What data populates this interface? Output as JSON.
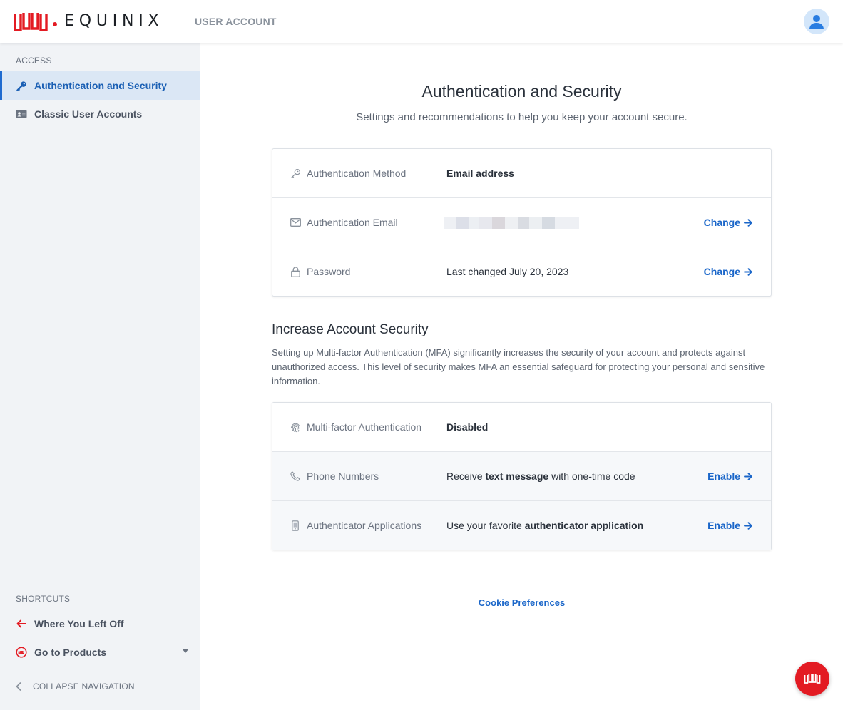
{
  "header": {
    "brand": "EQUINIX",
    "section": "USER ACCOUNT",
    "brand_color": "#e31b23"
  },
  "sidebar": {
    "access_heading": "ACCESS",
    "items": [
      {
        "label": "Authentication and Security",
        "icon": "key-icon",
        "active": true
      },
      {
        "label": "Classic User Accounts",
        "icon": "id-card-icon",
        "active": false
      }
    ],
    "shortcuts_heading": "SHORTCUTS",
    "shortcuts": [
      {
        "label": "Where You Left Off",
        "icon": "arrow-left-icon"
      },
      {
        "label": "Go to Products",
        "icon": "products-icon"
      }
    ],
    "collapse_label": "COLLAPSE NAVIGATION"
  },
  "main": {
    "title": "Authentication and Security",
    "subtitle": "Settings and recommendations to help you keep your account secure.",
    "auth_card": {
      "rows": [
        {
          "label": "Authentication Method",
          "icon": "key-icon",
          "value": "Email address"
        },
        {
          "label": "Authentication Email",
          "icon": "envelope-icon",
          "value": "",
          "action": "Change"
        },
        {
          "label": "Password",
          "icon": "lock-icon",
          "value": "Last changed July 20, 2023",
          "action": "Change"
        }
      ]
    },
    "security_section": {
      "title": "Increase Account Security",
      "description": "Setting up Multi-factor Authentication (MFA) significantly increases the security of your account and protects against unauthorized access. This level of security makes MFA an essential safeguard for protecting your personal and sensitive information."
    },
    "mfa_card": {
      "rows": [
        {
          "label": "Multi-factor Authentication",
          "icon": "fingerprint-icon",
          "value": "Disabled"
        },
        {
          "label": "Phone Numbers",
          "icon": "phone-icon",
          "value_pre": "Receive ",
          "value_bold": "text message",
          "value_post": " with one-time code",
          "action": "Enable"
        },
        {
          "label": "Authenticator Applications",
          "icon": "mobile-icon",
          "value_pre": "Use your favorite ",
          "value_bold": "authenticator application",
          "value_post": "",
          "action": "Enable"
        }
      ]
    },
    "cookie_link": "Cookie Preferences"
  },
  "colors": {
    "link": "#1a66c9",
    "active_nav_bg": "#dbe7f5",
    "sidebar_bg": "#f1f3f6"
  }
}
